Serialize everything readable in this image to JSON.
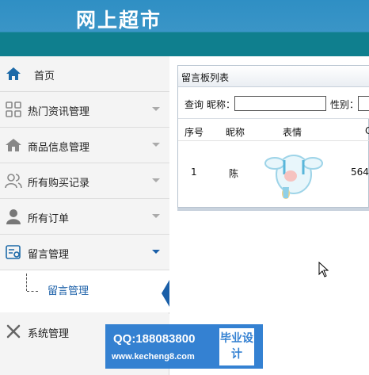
{
  "header": {
    "app_title": "网上超市"
  },
  "sidebar": {
    "items": [
      {
        "label": "首页",
        "icon": "home-icon"
      },
      {
        "label": "热门资讯管理",
        "icon": "grid-icon"
      },
      {
        "label": "商品信息管理",
        "icon": "house-icon"
      },
      {
        "label": "所有购买记录",
        "icon": "users-icon"
      },
      {
        "label": "所有订单",
        "icon": "user-icon"
      },
      {
        "label": "留言管理",
        "icon": "message-icon"
      },
      {
        "label": "系统管理",
        "icon": "tools-icon"
      }
    ],
    "sub_item": "留言管理"
  },
  "panel": {
    "title": "留言板列表",
    "search": {
      "query_label": "查询",
      "nickname_label": "昵称：",
      "gender_label": "性别："
    },
    "columns": [
      "序号",
      "昵称",
      "表情"
    ],
    "rows": [
      {
        "index": "1",
        "nickname": "陈",
        "extra": "564"
      }
    ]
  },
  "watermark": {
    "qq": "QQ:188083800",
    "site": "www.kecheng8.com",
    "badge": "毕业设计"
  },
  "colors": {
    "header_blue": "#3a95c7",
    "header_teal": "#0f7f8e",
    "accent": "#1a5fa8"
  }
}
